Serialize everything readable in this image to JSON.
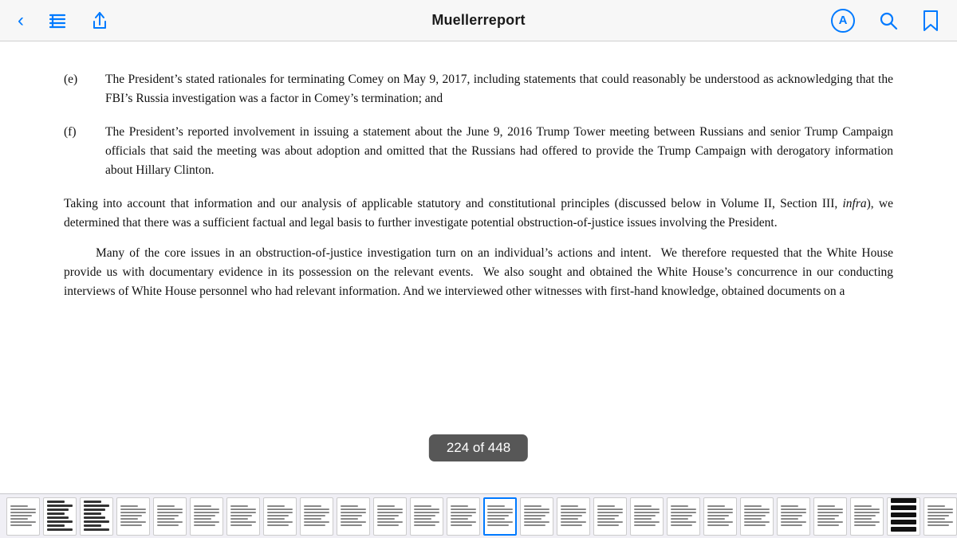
{
  "toolbar": {
    "title": "Muellerreport",
    "back_label": "‹",
    "icons": {
      "back": "back-icon",
      "list": "list-icon",
      "share": "share-icon",
      "annotate": "annotate-icon",
      "search": "search-icon",
      "bookmark": "bookmark-icon"
    }
  },
  "page_indicator": {
    "text": "224 of 448"
  },
  "content": {
    "item_e": "(e)",
    "item_e_text": "The President’s stated rationales for terminating Comey on May 9, 2017, including statements that could reasonably be understood as acknowledging that the FBI’s Russia investigation was a factor in Comey’s termination; and",
    "item_f": "(f)",
    "item_f_text": "The President’s reported involvement in issuing a statement about the June 9, 2016 Trump Tower meeting between Russians and senior Trump Campaign officials that said the meeting was about adoption and omitted that the Russians had offered to provide the Trump Campaign with derogatory information about Hillary Clinton.",
    "paragraph1": "Taking into account that information and our analysis of applicable statutory and constitutional principles (discussed below in Volume II, Section III, infra), we determined that there was a sufficient factual and legal basis to further investigate potential obstruction-of-justice issues involving the President.",
    "paragraph2_start": "Many of the core issues in an obstruction-of-justice investigation turn on an individual’s actions and intent.  We therefore requested that the White House provide us with documentary evidence in its possession on the relevant events.  We also sought and obtained the White House’s concurrence in our conducting interviews of White House personnel who had relevant information. And we interviewed other witnesses with first-hand knowledge, obtained documents on a"
  },
  "thumbnails": {
    "count": 27,
    "active_index": 13
  }
}
